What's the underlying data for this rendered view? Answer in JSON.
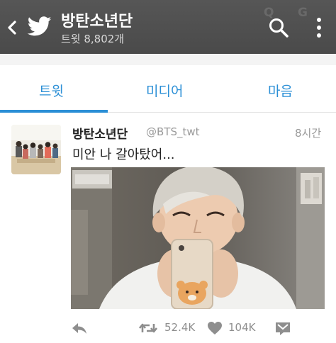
{
  "header": {
    "title": "방탄소년단",
    "subtitle": "트윗 8,802개",
    "faded_glyph_1": "Q",
    "faded_glyph_2": "G",
    "icons": [
      "back-icon",
      "twitter-bird-icon",
      "search-icon",
      "more-icon"
    ]
  },
  "tabs": [
    {
      "label": "트윗",
      "selected": true
    },
    {
      "label": "미디어",
      "selected": false
    },
    {
      "label": "마음",
      "selected": false
    }
  ],
  "tweet": {
    "author_name": "방탄소년단",
    "author_handle": "@BTS_twt",
    "time": "8시간",
    "text": "미안 나 갈아탔어...",
    "actions": {
      "retweet_count": "52.4K",
      "like_count": "104K"
    }
  },
  "colors": {
    "header_bg": "#4e4e4e",
    "accent": "#2b8fd6",
    "muted_text": "#9a9a9a"
  }
}
